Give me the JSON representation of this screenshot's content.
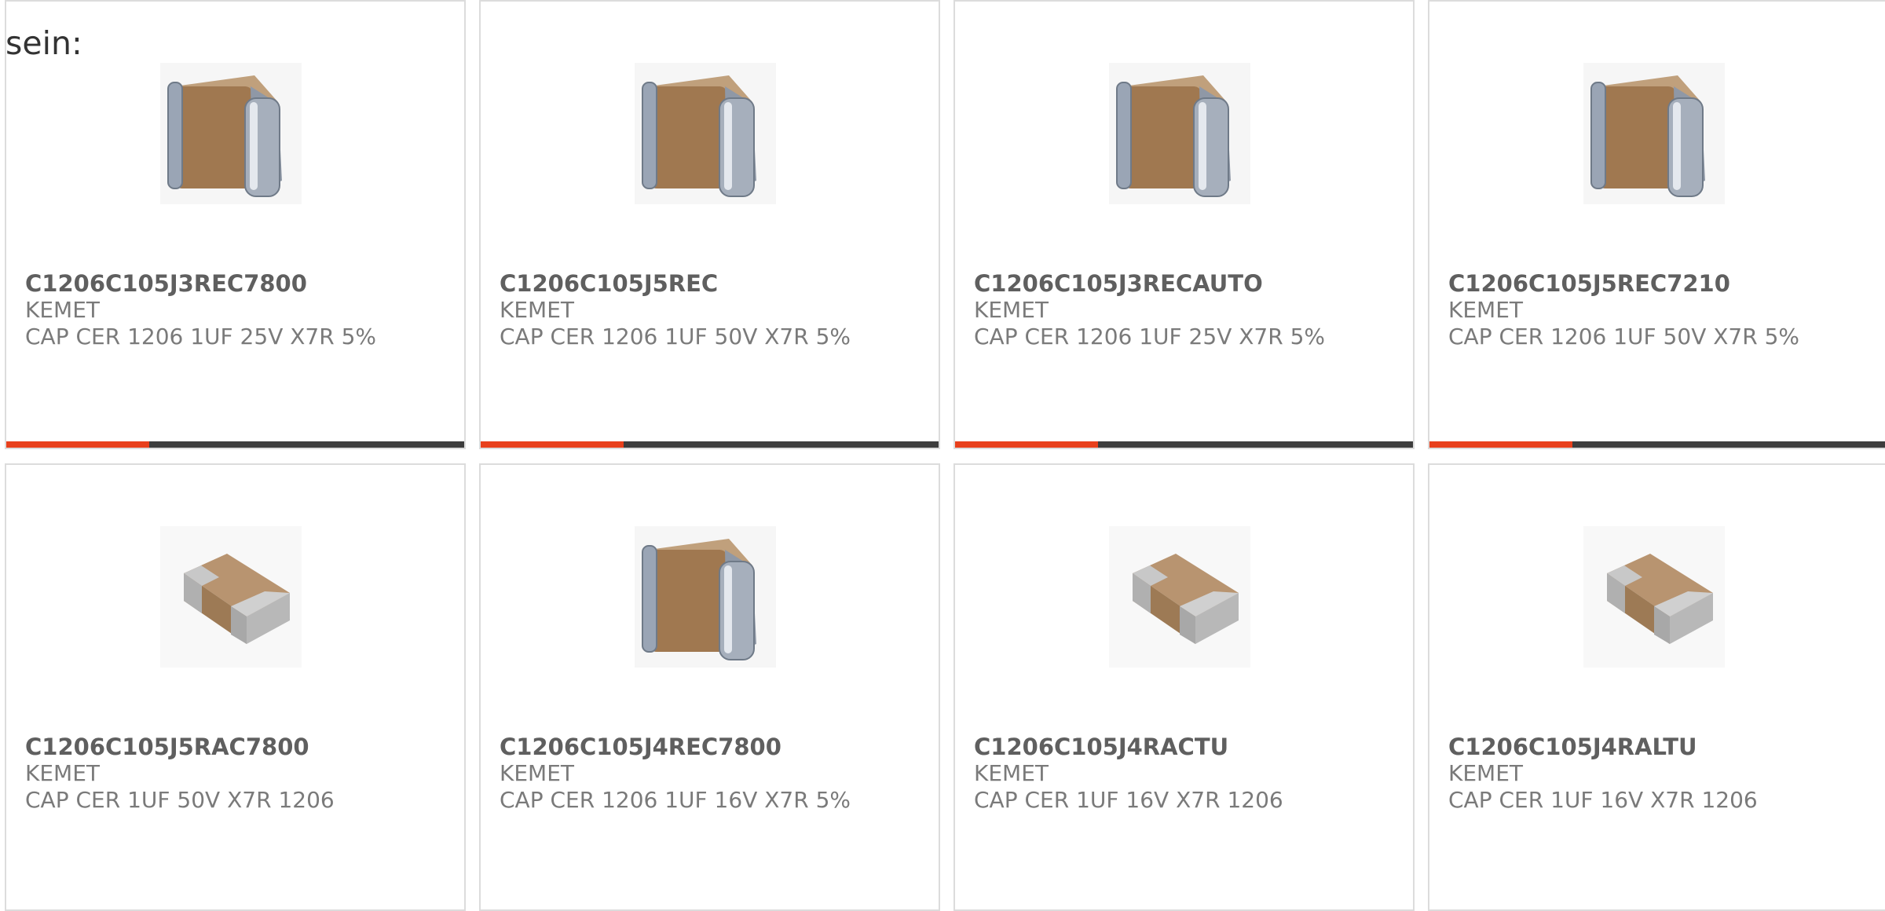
{
  "intro_text": "sein:",
  "colors": {
    "accent": "#e8401c",
    "bar": "#3d3d3d",
    "border": "#dcdcdc"
  },
  "products": [
    {
      "part": "C1206C105J3REC7800",
      "maker": "KEMET",
      "desc": "CAP CER 1206 1UF 25V X7R 5%",
      "image": "tall-mlcc-capacitor"
    },
    {
      "part": "C1206C105J5REC",
      "maker": "KEMET",
      "desc": "CAP CER 1206 1UF 50V X7R 5%",
      "image": "tall-mlcc-capacitor"
    },
    {
      "part": "C1206C105J3RECAUTO",
      "maker": "KEMET",
      "desc": "CAP CER 1206 1UF 25V X7R 5%",
      "image": "tall-mlcc-capacitor"
    },
    {
      "part": "C1206C105J5REC7210",
      "maker": "KEMET",
      "desc": "CAP CER 1206 1UF 50V X7R 5%",
      "image": "tall-mlcc-capacitor"
    },
    {
      "part": "C1206C105J5RAC7800",
      "maker": "KEMET",
      "desc": "CAP CER 1UF 50V X7R 1206",
      "image": "flat-chip-capacitor"
    },
    {
      "part": "C1206C105J4REC7800",
      "maker": "KEMET",
      "desc": "CAP CER 1206 1UF 16V X7R 5%",
      "image": "tall-mlcc-capacitor"
    },
    {
      "part": "C1206C105J4RACTU",
      "maker": "KEMET",
      "desc": "CAP CER 1UF 16V X7R 1206",
      "image": "flat-chip-capacitor"
    },
    {
      "part": "C1206C105J4RALTU",
      "maker": "KEMET",
      "desc": "CAP CER 1UF 16V X7R 1206",
      "image": "flat-chip-capacitor"
    }
  ]
}
